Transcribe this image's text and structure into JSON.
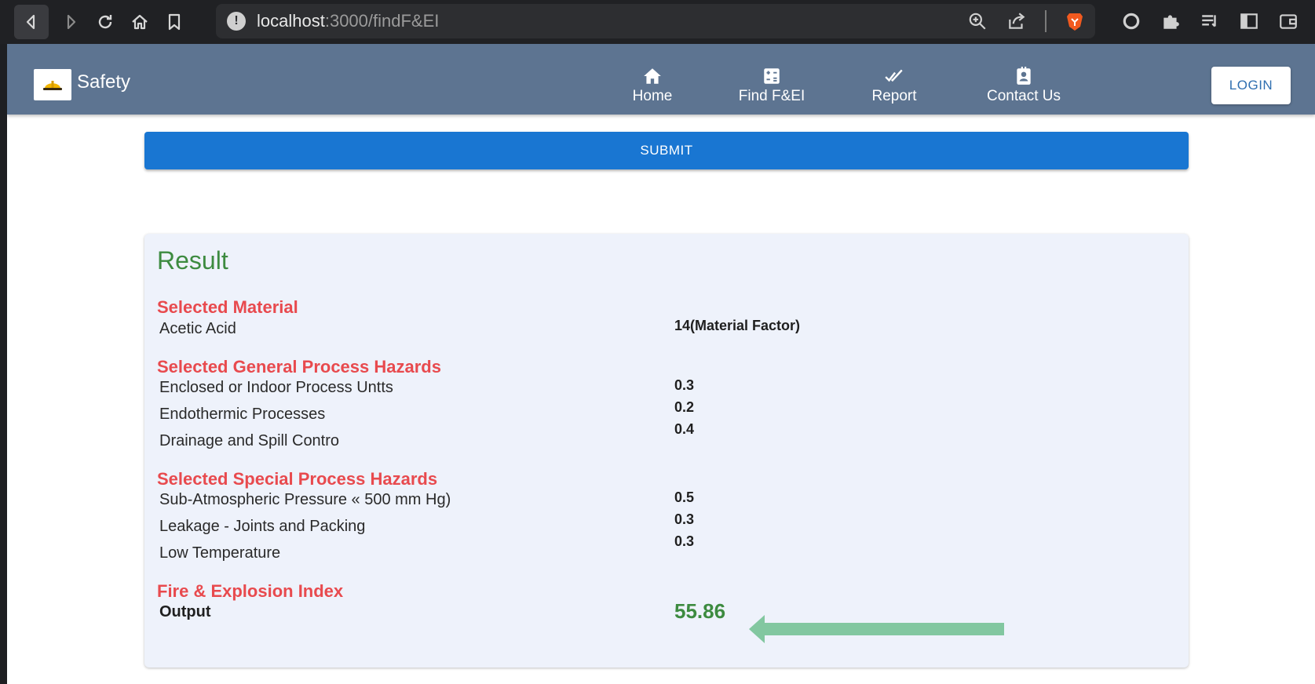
{
  "browser": {
    "url_host": "localhost",
    "url_rest": ":3000/findF&EI"
  },
  "app": {
    "brand": "Safety",
    "nav": [
      {
        "label": "Home",
        "icon": "home-icon"
      },
      {
        "label": "Find F&EI",
        "icon": "calculator-icon"
      },
      {
        "label": "Report",
        "icon": "double-check-icon"
      },
      {
        "label": "Contact Us",
        "icon": "contact-card-icon"
      }
    ],
    "login_label": "LOGIN"
  },
  "form": {
    "submit_label": "SUBMIT"
  },
  "result": {
    "title": "Result",
    "material_heading": "Selected Material",
    "material_name": "Acetic Acid",
    "material_factor": "14(Material Factor)",
    "general_heading": "Selected General Process Hazards",
    "general_items": [
      "Enclosed or Indoor Process Untts",
      "Endothermic Processes",
      "Drainage and Spill Contro"
    ],
    "general_values": [
      "0.3",
      "0.2",
      "0.4"
    ],
    "special_heading": "Selected Special Process Hazards",
    "special_items": [
      "Sub-Atmospheric Pressure « 500 mm Hg)",
      "Leakage - Joints and Packing",
      "Low Temperature"
    ],
    "special_values": [
      "0.5",
      "0.3",
      "0.3"
    ],
    "index_heading": "Fire & Explosion Index",
    "output_label": "Output",
    "output_value": "55.86"
  },
  "colors": {
    "appbar": "#5d7491",
    "submit": "#1976d2",
    "heading_red": "#e84a4e",
    "result_green": "#3d8b40",
    "arrow": "#82c7a0"
  }
}
